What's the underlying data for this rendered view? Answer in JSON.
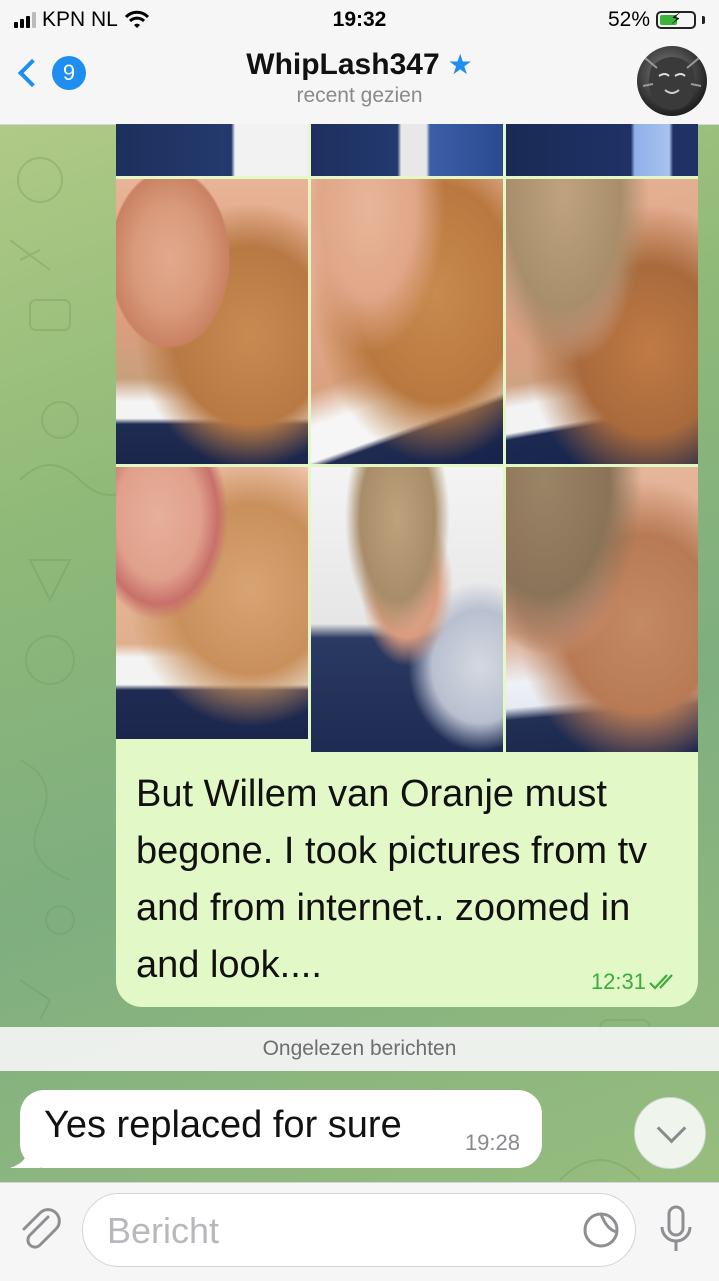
{
  "status_bar": {
    "carrier": "KPN NL",
    "time": "19:32",
    "battery_percent_label": "52%",
    "battery_level": 0.52,
    "icons": [
      "signal-icon",
      "wifi-icon",
      "battery-charging-icon"
    ]
  },
  "header": {
    "back_badge_count": "9",
    "contact_name": "WhipLash347",
    "status": "recent gezien",
    "icons": [
      "back-chevron-icon",
      "star-icon",
      "avatar"
    ]
  },
  "messages": {
    "outgoing": {
      "text": "But Willem van Oranje must begone. I took pictures from tv and from internet.. zoomed in and look....",
      "time": "12:31",
      "read_icon": "double-check-icon",
      "photo_count": 9
    },
    "unread_divider": "Ongelezen berichten",
    "incoming": {
      "text": "Yes replaced for sure",
      "time": "19:28"
    }
  },
  "input": {
    "placeholder": "Bericht",
    "icons": [
      "paperclip-icon",
      "sticker-icon",
      "microphone-icon",
      "chevron-down-icon"
    ]
  },
  "colors": {
    "accent": "#1f8ef1",
    "outgoing_bubble": "#e2f8c6",
    "read_check": "#3cac3c"
  }
}
